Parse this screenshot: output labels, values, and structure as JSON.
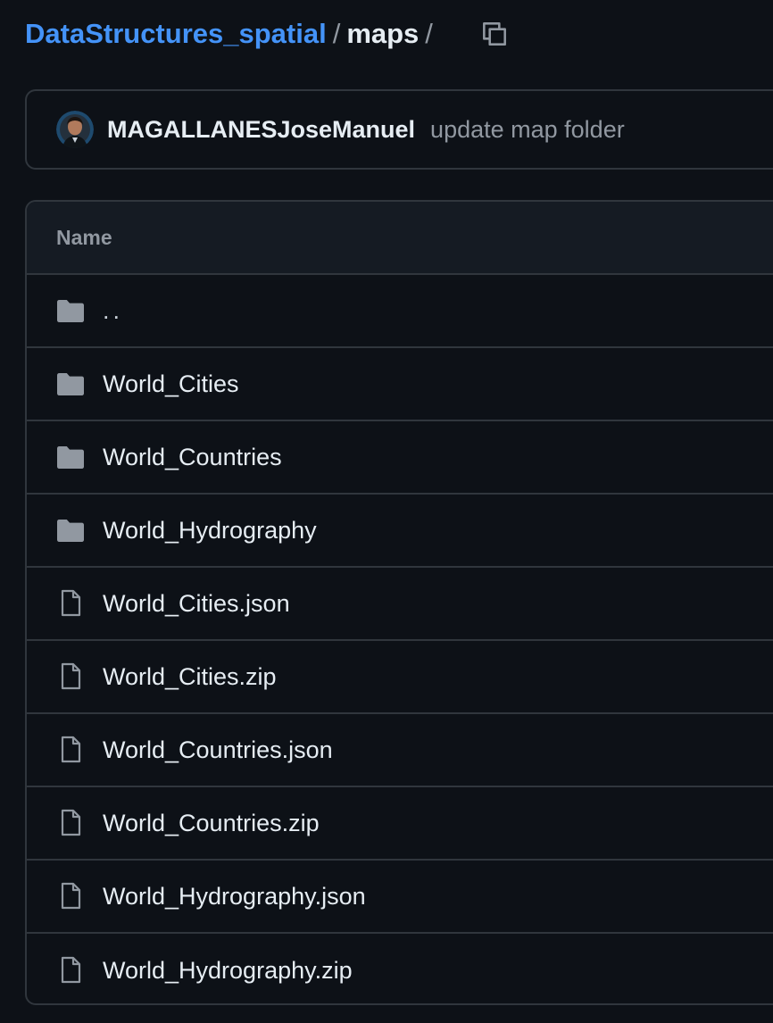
{
  "breadcrumb": {
    "repo": "DataStructures_spatial",
    "separator": "/",
    "current": "maps",
    "trailing_separator": "/"
  },
  "copy_path_icon": "copy-icon",
  "commit": {
    "avatar_icon": "user-avatar",
    "author": "MAGALLANESJoseManuel",
    "message": "update map folder"
  },
  "table": {
    "header_name": "Name",
    "rows": [
      {
        "label": "..",
        "type": "folder",
        "icon": "folder-icon"
      },
      {
        "label": "World_Cities",
        "type": "folder",
        "icon": "folder-icon"
      },
      {
        "label": "World_Countries",
        "type": "folder",
        "icon": "folder-icon"
      },
      {
        "label": "World_Hydrography",
        "type": "folder",
        "icon": "folder-icon"
      },
      {
        "label": "World_Cities.json",
        "type": "file",
        "icon": "file-icon"
      },
      {
        "label": "World_Cities.zip",
        "type": "file",
        "icon": "file-icon"
      },
      {
        "label": "World_Countries.json",
        "type": "file",
        "icon": "file-icon"
      },
      {
        "label": "World_Countries.zip",
        "type": "file",
        "icon": "file-icon"
      },
      {
        "label": "World_Hydrography.json",
        "type": "file",
        "icon": "file-icon"
      },
      {
        "label": "World_Hydrography.zip",
        "type": "file",
        "icon": "file-icon"
      }
    ]
  },
  "colors": {
    "background": "#0d1117",
    "link": "#4493f8",
    "border": "#30363d",
    "muted_text": "#9198a1",
    "icon": "#9198a1"
  }
}
